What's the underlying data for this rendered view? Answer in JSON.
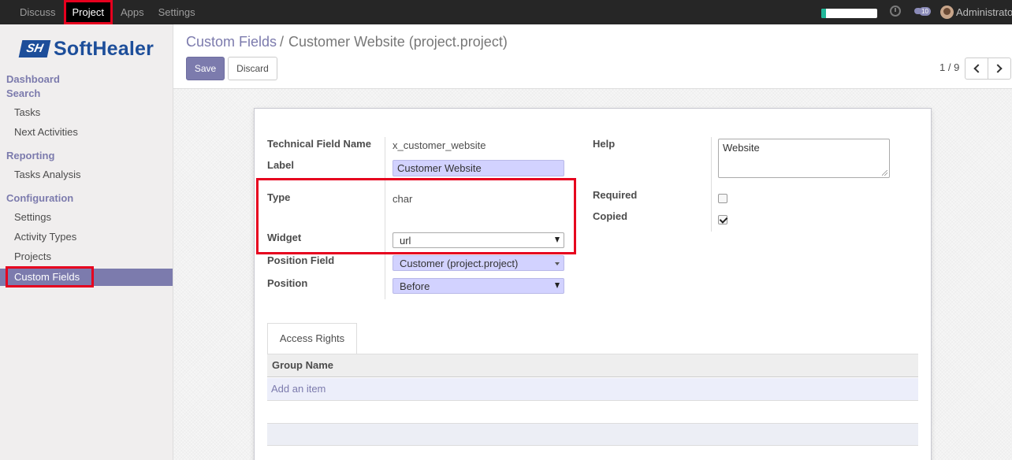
{
  "topbar": {
    "menu": [
      "Discuss",
      "Project",
      "Apps",
      "Settings"
    ],
    "active_menu": "Project",
    "notification_count": "10",
    "user_name": "Administrator",
    "colors": {
      "bar": "#262626",
      "highlight": "#e6001e"
    }
  },
  "sidebar": {
    "logo_mark": "SH",
    "logo_text": "SoftHealer",
    "dashboard_label": "Dashboard",
    "search_label": "Search",
    "items_search": [
      "Tasks",
      "Next Activities"
    ],
    "reporting_label": "Reporting",
    "items_reporting": [
      "Tasks Analysis"
    ],
    "configuration_label": "Configuration",
    "items_configuration": [
      "Settings",
      "Activity Types",
      "Projects"
    ],
    "active_item": "Custom Fields"
  },
  "control_panel": {
    "breadcrumb_parent": "Custom Fields",
    "breadcrumb_sep": "/",
    "breadcrumb_current": "Customer Website (project.project)",
    "save_label": "Save",
    "discard_label": "Discard",
    "pager": "1 / 9"
  },
  "form": {
    "technical_field_name_label": "Technical Field Name",
    "technical_field_name_value": "x_customer_website",
    "label_label": "Label",
    "label_value": "Customer Website",
    "type_label": "Type",
    "type_value": "char",
    "widget_label": "Widget",
    "widget_value": "url",
    "position_field_label": "Position Field",
    "position_field_value": "Customer (project.project)",
    "position_label": "Position",
    "position_value": "Before",
    "help_label": "Help",
    "help_value": "Website",
    "required_label": "Required",
    "required_checked": false,
    "copied_label": "Copied",
    "copied_checked": true
  },
  "notebook": {
    "tab_label": "Access Rights",
    "column_header": "Group Name",
    "add_item_label": "Add an item"
  },
  "colors": {
    "accent": "#7c7bad",
    "input_bg": "#d2d2ff"
  }
}
